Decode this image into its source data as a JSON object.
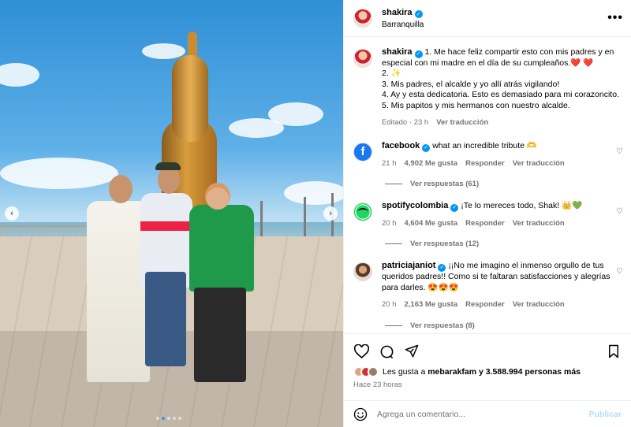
{
  "post": {
    "username": "shakira",
    "location": "Barranquilla",
    "more_label": "•••",
    "prev_label": "‹",
    "next_label": "›",
    "image_count": 5,
    "active_image": 2,
    "caption": {
      "username": "shakira",
      "lines": [
        "1. Me hace feliz compartir esto con mis padres y en especial con mi madre en el día de su cumpleaños.❤️ ❤️",
        "2. ✨",
        "3. Mis padres, el alcalde y yo allí atrás vigilando!",
        "4. Ay y esta dedicatoria. Esto es demasiado para mi corazoncito.",
        "5. Mis papitos y mis hermanos con nuestro alcalde."
      ],
      "edited_label": "Editado",
      "time": "23 h",
      "translate_label": "Ver traducción"
    }
  },
  "comments": [
    {
      "username": "facebook",
      "text": "what an incredible tribute 🫶",
      "time": "21 h",
      "likes": "4,902 Me gusta",
      "reply_label": "Responder",
      "translate_label": "Ver traducción",
      "replies_label": "Ver respuestas (61)"
    },
    {
      "username": "spotifycolombia",
      "text": "¡Te lo mereces todo, Shak! 👑💚",
      "time": "20 h",
      "likes": "4,604 Me gusta",
      "reply_label": "Responder",
      "translate_label": "Ver traducción",
      "replies_label": "Ver respuestas (12)"
    },
    {
      "username": "patriciajaniot",
      "text": "¡¡No me imagino el inmenso orgullo de tus queridos padres!! Como si te faltaran satisfacciones y alegrías para darles. 😍😍😍",
      "time": "20 h",
      "likes": "2,163 Me gusta",
      "reply_label": "Responder",
      "translate_label": "Ver traducción",
      "replies_label": "Ver respuestas (8)"
    }
  ],
  "footer": {
    "likes_prefix": "Les gusta a ",
    "likes_user": "mebarakfam",
    "likes_suffix": " y 3.588.994 personas más",
    "posted": "Hace 23 horas",
    "comment_placeholder": "Agrega un comentario...",
    "publish_label": "Publicar"
  },
  "icons": {
    "verified": "verified-badge-icon",
    "heart": "heart-icon",
    "comment": "comment-icon",
    "share": "share-icon",
    "save": "bookmark-icon",
    "emoji": "emoji-icon"
  },
  "colors": {
    "accent": "#0095f6",
    "meta_text": "#737373",
    "publish_disabled": "#b3dbff",
    "facebook": "#1877f2",
    "spotify": "#1ed760"
  }
}
